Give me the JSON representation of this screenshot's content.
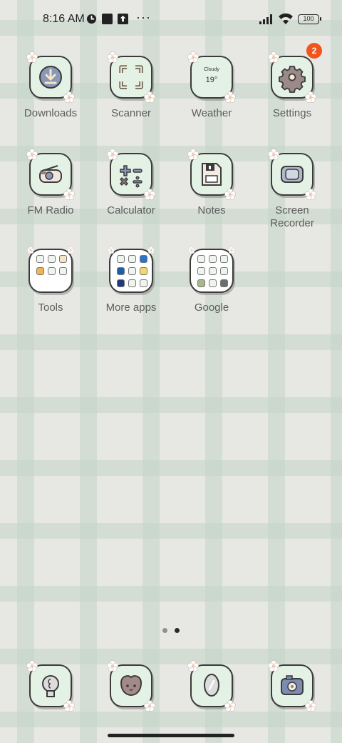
{
  "status": {
    "time": "8:16 AM",
    "battery": "100",
    "more_indicator": "···"
  },
  "apps": [
    {
      "label": "Downloads",
      "icon": "download-icon"
    },
    {
      "label": "Scanner",
      "icon": "scan-icon"
    },
    {
      "label": "Weather",
      "icon": "weather-icon",
      "condition": "Cloudy",
      "temperature": "19°"
    },
    {
      "label": "Settings",
      "icon": "gear-icon",
      "badge": "2"
    },
    {
      "label": "FM Radio",
      "icon": "radio-icon"
    },
    {
      "label": "Calculator",
      "icon": "calculator-icon"
    },
    {
      "label": "Notes",
      "icon": "notes-icon"
    },
    {
      "label": "Screen\nRecorder",
      "icon": "screen-recorder-icon"
    },
    {
      "label": "Tools",
      "icon": "folder-icon"
    },
    {
      "label": "More apps",
      "icon": "folder-icon"
    },
    {
      "label": "Google",
      "icon": "folder-icon"
    }
  ],
  "dock": [
    {
      "icon": "lightbulb-icon"
    },
    {
      "icon": "bear-face-icon"
    },
    {
      "icon": "mirror-icon"
    },
    {
      "icon": "camera-icon"
    }
  ],
  "pager": {
    "pages": 2,
    "current": 2
  },
  "colors": {
    "tile_bg": "#e4f2e6",
    "outline": "#3b3b3b",
    "label": "#5d5d5d",
    "badge": "#f2541b"
  }
}
